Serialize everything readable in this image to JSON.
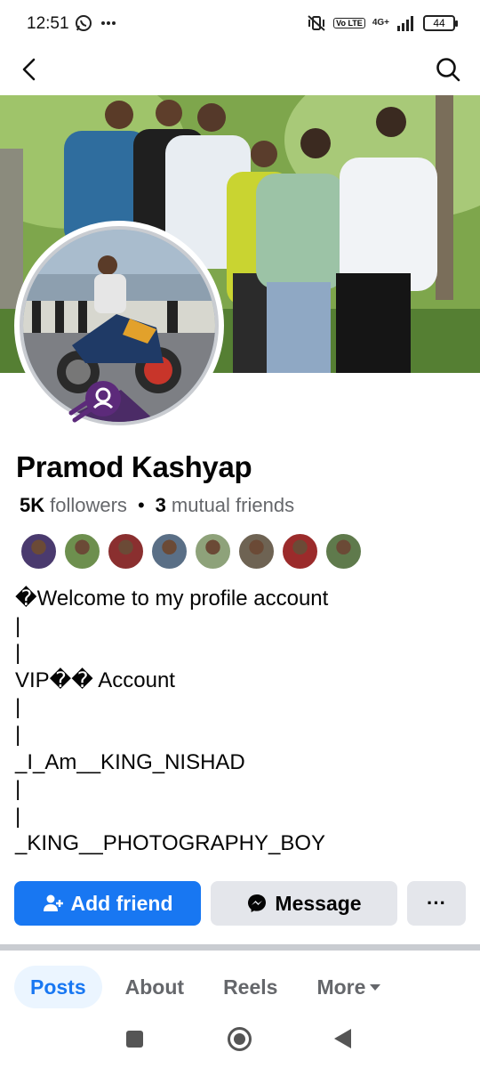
{
  "status_bar": {
    "time": "12:51",
    "left_icons": [
      "whatsapp-icon",
      "more-dots-icon"
    ],
    "right_icons": [
      "vibrate-off-icon",
      "volte-icon",
      "signal-4g-icon"
    ],
    "volte_label": "Vo LTE",
    "network_label": "4G+",
    "battery": "44"
  },
  "app_bar": {
    "back_icon": "back-arrow-icon",
    "search_icon": "search-icon"
  },
  "profile": {
    "name": "Pramod Kashyap",
    "followers_count": "5K",
    "followers_label": "followers",
    "mutual_count": "3",
    "mutual_label": "mutual friends",
    "separator": "•",
    "avatar_badge_icon": "profile-guard-icon"
  },
  "friend_avatars": [
    {
      "color": "#4a3a6e"
    },
    {
      "color": "#6d8f4e"
    },
    {
      "color": "#8a2f2f"
    },
    {
      "color": "#5a6f86"
    },
    {
      "color": "#8ea27a"
    },
    {
      "color": "#6e6353"
    },
    {
      "color": "#9b2b2b"
    },
    {
      "color": "#5f7a4c"
    }
  ],
  "bio": {
    "lines": [
      "�Welcome to my profile account",
      "|",
      "|",
      "VIP�� Account",
      "|",
      "|",
      "_I_Am__KING_NISHAD",
      "|",
      "|",
      "_KING__PHOTOGRAPHY_BOY"
    ]
  },
  "actions": {
    "add_friend": "Add friend",
    "message": "Message",
    "more": "···"
  },
  "tabs": [
    {
      "label": "Posts",
      "active": true
    },
    {
      "label": "About",
      "active": false
    },
    {
      "label": "Reels",
      "active": false
    },
    {
      "label": "More",
      "active": false
    }
  ],
  "colors": {
    "primary": "#1877f2",
    "secondary_button": "#e4e6eb",
    "active_tab_bg": "#ebf5ff",
    "muted_text": "#65676b"
  }
}
